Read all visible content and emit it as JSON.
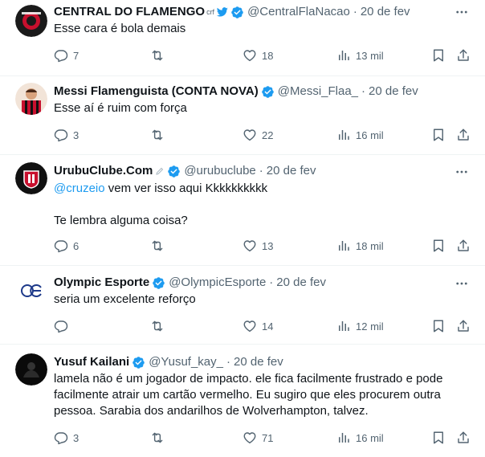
{
  "tweets": [
    {
      "name": "CENTRAL DO FLAMENGO",
      "name_extra": "crf",
      "handle": "@CentralFlaNacao",
      "time": "20 de fev",
      "text": "Esse cara é bola demais",
      "replies": "7",
      "retweets": "",
      "likes": "18",
      "views": "13 mil",
      "avatar_text": "CENTRAL DO FLAMENGO"
    },
    {
      "name": "Messi Flamenguista (CONTA NOVA)",
      "handle": "@Messi_Flaa_",
      "time": "20 de fev",
      "text": "Esse aí é ruim com força",
      "replies": "3",
      "retweets": "",
      "likes": "22",
      "views": "16 mil"
    },
    {
      "name": "UrubuClube.Com",
      "handle": "@urubuclube",
      "time": "20 de fev",
      "mention": "@cruzeio",
      "text_line1_rest": " vem ver isso aqui Kkkkkkkkkk",
      "text_line2": "Te lembra alguma coisa?",
      "replies": "6",
      "retweets": "",
      "likes": "13",
      "views": "18 mil"
    },
    {
      "name": "Olympic Esporte",
      "handle": "@OlympicEsporte",
      "time": "20 de fev",
      "text": "seria um excelente reforço",
      "replies": "",
      "retweets": "",
      "likes": "14",
      "views": "12 mil"
    },
    {
      "name": "Yusuf Kailani",
      "handle": "@Yusuf_kay_",
      "time": "20 de fev",
      "text_lines": [
        "lamela não é um jogador de impacto.  ele fica facilmente frustrado e pode",
        "facilmente atrair um cartão vermelho.  Eu sugiro que eles procurem outra",
        "pessoa.  Sarabia dos andarilhos de Wolverhampton, talvez."
      ],
      "replies": "3",
      "retweets": "",
      "likes": "71",
      "views": "16 mil"
    }
  ],
  "colors": {
    "text": "#0f1419",
    "secondary": "#536471",
    "link": "#1d9bf0",
    "verified": "#1d9bf0",
    "divider": "#eff3f4"
  }
}
